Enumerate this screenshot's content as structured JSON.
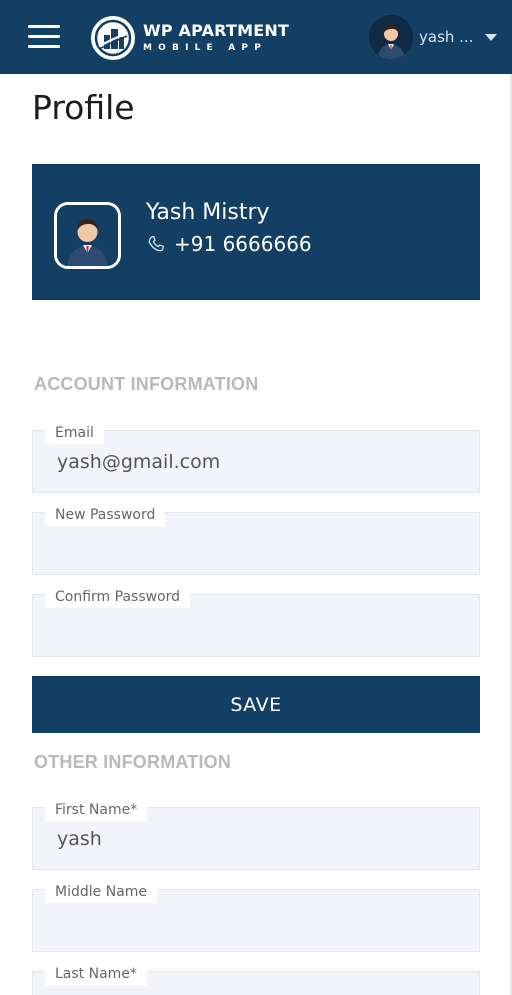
{
  "header": {
    "logo_title": "WP APARTMENT",
    "logo_subtitle": "MOBILE APP",
    "user_name": "yash ...",
    "menu_icon": "hamburger-icon",
    "caret_icon": "chevron-down-icon"
  },
  "page": {
    "title": "Profile"
  },
  "profile": {
    "name": "Yash Mistry",
    "phone": "+91  6666666",
    "phone_icon": "phone-icon"
  },
  "account_section": {
    "heading": "ACCOUNT INFORMATION",
    "email_label": "Email",
    "email_value": "yash@gmail.com",
    "new_password_label": "New Password",
    "new_password_value": "",
    "confirm_password_label": "Confirm Password",
    "confirm_password_value": "",
    "save_label": "SAVE"
  },
  "other_section": {
    "heading": "OTHER INFORMATION",
    "first_name_label": "First Name*",
    "first_name_value": "yash",
    "middle_name_label": "Middle Name",
    "middle_name_value": "",
    "last_name_label": "Last Name*",
    "last_name_value": ""
  },
  "colors": {
    "primary": "#123f63",
    "field_bg": "#f2f4f9",
    "heading_gray": "#b9b9b9"
  }
}
